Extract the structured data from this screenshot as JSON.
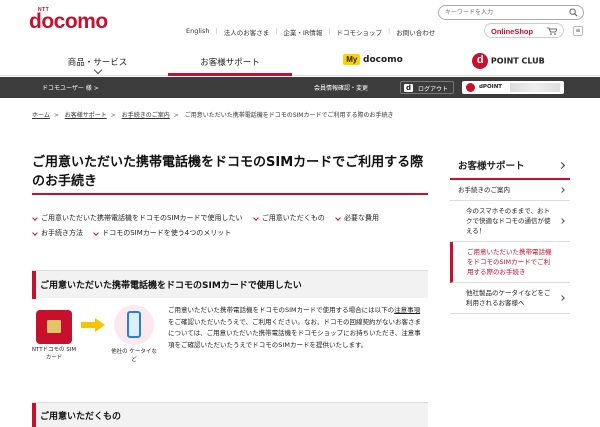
{
  "header": {
    "ntt_label": "NTT",
    "logo_text": "docomo",
    "search_placeholder": "キーワードを入力",
    "top_links": [
      "English",
      "法人のお客さま",
      "企業・IR情報",
      "ドコモショップ",
      "お問い合わせ"
    ],
    "online_shop": "OnlineShop"
  },
  "global_nav": {
    "products": "商品・サービス",
    "support": "お客様サポート",
    "my_badge": "My",
    "my_docomo": "docomo",
    "dpoint_d": "d",
    "dpoint_club": "POINT CLUB"
  },
  "user_bar": {
    "user": "ドコモユーザー 様 >",
    "account": "会員情報確認・変更",
    "logout_d": "d",
    "logout": "ログアウト",
    "dpoint": "dPOINT"
  },
  "breadcrumb": {
    "items": [
      "ホーム",
      "お客様サポート",
      "お手続きのご案内"
    ],
    "current": "ご用意いただいた携帯電話機をドコモのSIMカードでご利用する際のお手続き"
  },
  "main": {
    "title": "ご用意いただいた携帯電話機をドコモのSIMカードでご利用する際のお手続き",
    "anchors": [
      "ご用意いただいた携帯電話機をドコモのSIMカードで使用したい",
      "ご用意いただくもの",
      "必要な費用",
      "お手続き方法",
      "ドコモのSIMカードを使う4つのメリット"
    ],
    "section1_title": "ご用意いただいた携帯電話機をドコモのSIMカードで使用したい",
    "sim_label": "NTTドコモの SIMカード",
    "phone_label": "他社の ケータイなど",
    "body_1": "ご用意いただいた携帯電話機をドコモのSIMカードで使用する場合には以下の",
    "body_link": "注意事項",
    "body_2": "をご確認いただいたうえで、ご利用ください。なお、ドコモの回線契約がないお客さまについては、ご用意いただいた携帯電話機をドコモショップにお持ちいただき、注意事項をご確認いただいたうえでドコモのSIMカードを提供いたします。",
    "section2_title": "ご用意いただくもの"
  },
  "sidebar": {
    "heading": "お客様サポート",
    "items": [
      "お手続きのご案内",
      "今のスマホそのままで、おトクで快適なドコモの通信が使える！",
      "ご用意いただいた携帯電話機をドコモのSIMカードでご利用する際のお手続き",
      "他社製品のケータイなどをご利用されるお客様へ"
    ]
  },
  "colors": {
    "brand": "#c8102e",
    "dark_bar": "#3c3c3c"
  }
}
